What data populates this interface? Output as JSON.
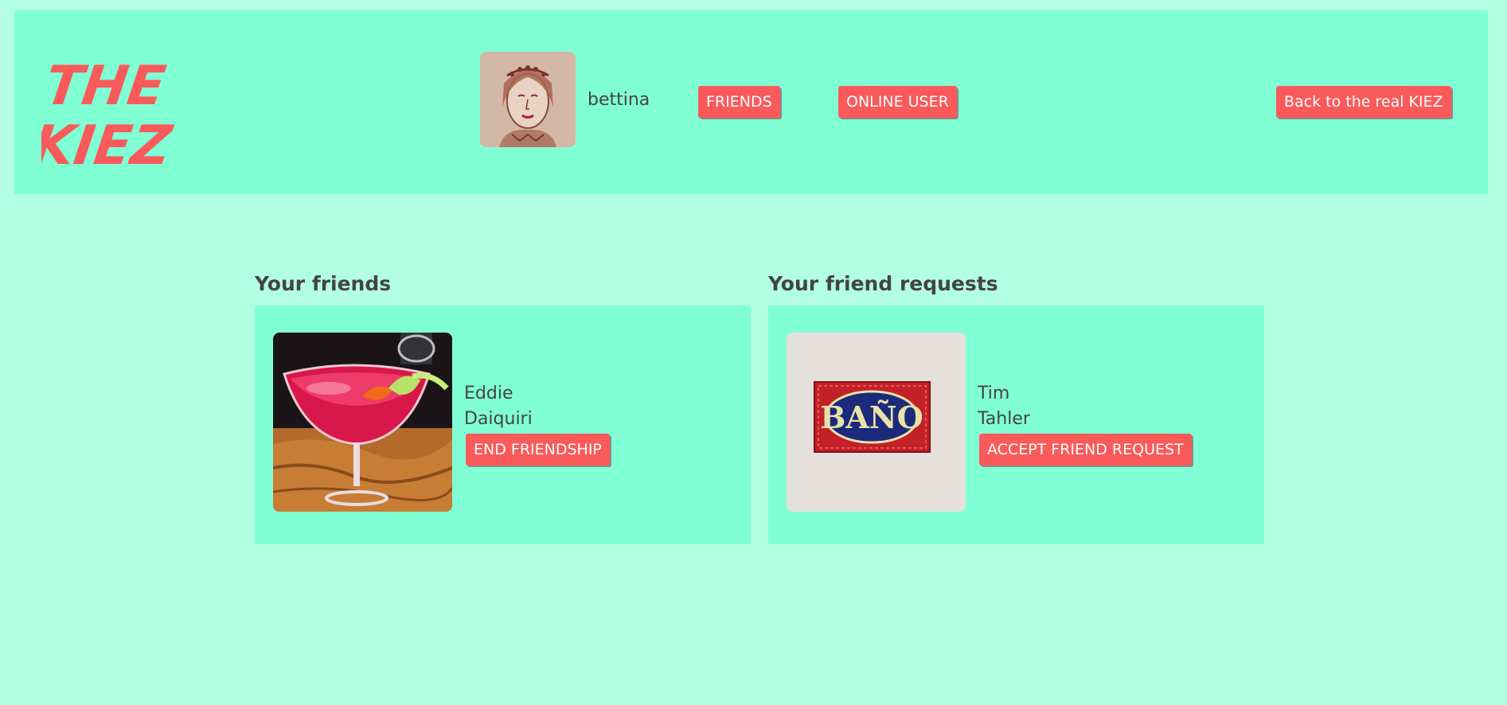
{
  "header": {
    "logo_text_line1": "THE",
    "logo_text_line2": "KIEZ",
    "username": "bettina",
    "nav": {
      "friends_label": "FRIENDS",
      "online_label": "ONLINE USER",
      "back_label": "Back to the real KIEZ"
    }
  },
  "friends": {
    "title": "Your friends",
    "items": [
      {
        "first_name": "Eddie",
        "last_name": "Daiquiri",
        "action_label": "END FRIENDSHIP"
      }
    ]
  },
  "requests": {
    "title": "Your friend requests",
    "items": [
      {
        "first_name": "Tim",
        "last_name": "Tahler",
        "action_label": "ACCEPT FRIEND REQUEST",
        "image_sign_text": "BAÑO"
      }
    ]
  },
  "colors": {
    "page_bg": "#b3ffe3",
    "panel_bg": "#80ffd5",
    "accent": "#fa5a5a",
    "text": "#444444"
  }
}
